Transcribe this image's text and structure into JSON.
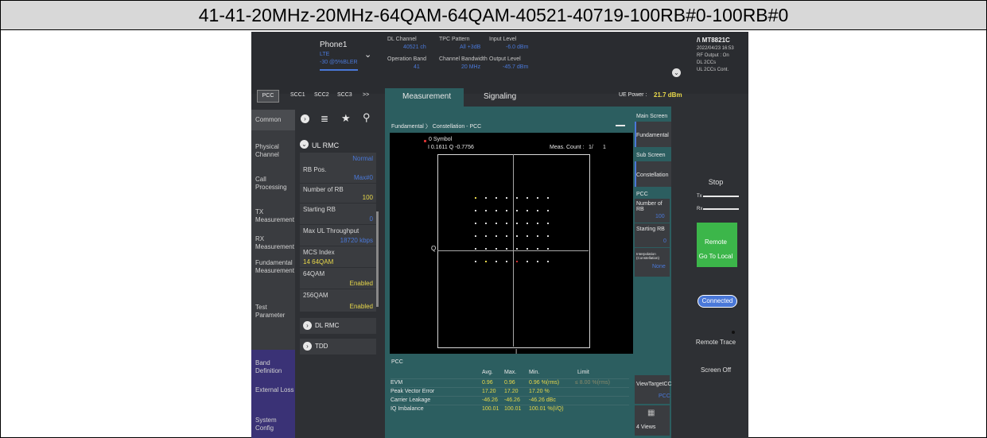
{
  "title": "41-41-20MHz-20MHz-64QAM-64QAM-40521-40719-100RB#0-100RB#0",
  "header": {
    "phone": "Phone1",
    "phone_tech": "LTE",
    "phone_sub": "-30 @5%BLER",
    "dl_channel_label": "DL Channel",
    "dl_channel_value": "40521 ch",
    "tpc_label": "TPC Pattern",
    "tpc_value": "All +3dB",
    "input_level_label": "Input Level",
    "input_level_value": "-6.0 dBm",
    "op_band_label": "Operation Band",
    "op_band_value": "41",
    "ch_bw_label": "Channel Bandwidth",
    "ch_bw_value": "20 MHz",
    "output_level_label": "Output Level",
    "output_level_value": "-45.7 dBm",
    "instrument": "/\\ MT8821C",
    "datetime": "2022/04/23 16:53",
    "rf_output": "RF Output : On",
    "dl_ccs": "DL 2CCs",
    "ul_ccs": "UL 2CCs Cont."
  },
  "cc_tabs": [
    "PCC",
    "SCC1",
    "SCC2",
    "SCC3",
    ">>"
  ],
  "main_tabs": [
    "Measurement",
    "Signaling"
  ],
  "ue_power_label": "UE Power :",
  "ue_power_value": "21.7 dBm",
  "nav": {
    "common": "Common",
    "items": [
      "Physical Channel",
      "Call Processing",
      "TX Measurement",
      "RX Measurement",
      "Fundamental Measurement",
      "Test Parameter"
    ],
    "bottom": [
      "Band Definition",
      "External Loss",
      "System Config"
    ]
  },
  "params": {
    "section": "UL RMC",
    "rows": [
      {
        "label": "",
        "value": "Normal"
      },
      {
        "label": "RB Pos.",
        "value": "Max#0"
      },
      {
        "label": "Number of RB",
        "value": "100"
      },
      {
        "label": "Starting RB",
        "value": "0"
      },
      {
        "label": "Max UL Throughput",
        "value": "18720 kbps"
      },
      {
        "label": "MCS Index",
        "value": "14  64QAM"
      },
      {
        "label": "64QAM",
        "value": "Enabled"
      },
      {
        "label": "256QAM",
        "value": "Enabled"
      }
    ],
    "dl_rmc": "DL RMC",
    "tdd": "TDD"
  },
  "measurement": {
    "breadcrumb_1": "Fundamental",
    "breadcrumb_2": "Constellation - PCC",
    "symbol_label": "0 Symbol",
    "symbol_value": "I 0.1611 Q -0.7756",
    "meas_count_label": "Meas. Count :",
    "meas_count_value": "1/",
    "meas_count_total": "1",
    "axis_q": "Q",
    "axis_i": "I"
  },
  "results": {
    "cc": "PCC",
    "headers": [
      "Avg.",
      "Max.",
      "Min.",
      "Limit"
    ],
    "rows": [
      {
        "name": "EVM",
        "avg": "0.96",
        "max": "0.96",
        "min": "0.96 %(rms)",
        "limit": "≤ 8.00 %(rms)"
      },
      {
        "name": "Peak Vector Error",
        "avg": "17.20",
        "max": "17.20",
        "min": "17.20 %",
        "limit": ""
      },
      {
        "name": "Carrier Leakage",
        "avg": "-46.26",
        "max": "-46.26",
        "min": "-46.26 dBc",
        "limit": ""
      },
      {
        "name": "IQ Imbalance",
        "avg": "100.01",
        "max": "100.01",
        "min": "100.01 %(I/Q)",
        "limit": ""
      }
    ]
  },
  "right_panel": {
    "main_screen": "Main Screen",
    "fundamental": "Fundamental",
    "sub_screen": "Sub Screen",
    "constellation": "Constellation",
    "pcc": "PCC",
    "num_rb_label": "Number of RB",
    "num_rb_value": "100",
    "start_rb_label": "Starting RB",
    "start_rb_value": "0",
    "interp_label": "Interpolation (Constellation)",
    "interp_value": "None",
    "view_target": "ViewTargetCC",
    "view_target_value": "PCC",
    "views": "4 Views"
  },
  "side_buttons": {
    "stop": "Stop",
    "tx": "Tx",
    "rx": "Rx",
    "remote": "Remote",
    "go_local": "Go To Local",
    "connected": "Connected",
    "remote_trace": "Remote Trace",
    "screen_off": "Screen Off"
  },
  "colors": {
    "teal": "#2c5e60",
    "green": "#3cb64a",
    "blue": "#4a78d8",
    "yellow": "#e8d84a"
  }
}
